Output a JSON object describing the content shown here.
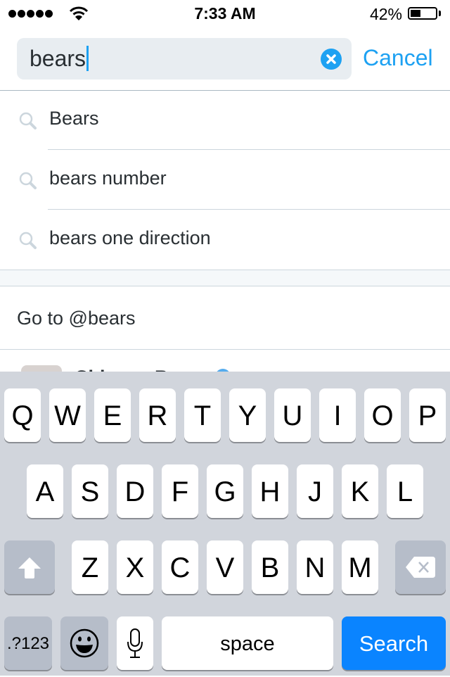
{
  "status_bar": {
    "signal_bars": 5,
    "time": "7:33 AM",
    "battery_percent_label": "42%",
    "battery_level": 0.42
  },
  "search": {
    "query": "bears",
    "clear_icon": "clear-circle-icon",
    "cancel_label": "Cancel",
    "accent_color": "#1da1f2"
  },
  "suggestions": [
    {
      "label": "Bears",
      "icon": "search-icon"
    },
    {
      "label": "bears number",
      "icon": "search-icon"
    },
    {
      "label": "bears one direction",
      "icon": "search-icon"
    }
  ],
  "goto": {
    "label": "Go to @bears"
  },
  "user_result": {
    "name": "Chicago Bears",
    "verified": true
  },
  "keyboard": {
    "row1": [
      "Q",
      "W",
      "E",
      "R",
      "T",
      "Y",
      "U",
      "I",
      "O",
      "P"
    ],
    "row2": [
      "A",
      "S",
      "D",
      "F",
      "G",
      "H",
      "J",
      "K",
      "L"
    ],
    "row3": [
      "Z",
      "X",
      "C",
      "V",
      "B",
      "N",
      "M"
    ],
    "shift_icon": "shift-arrow-icon",
    "delete_icon": "backspace-icon",
    "numbers_label": ".?123",
    "emoji_icon": "emoji-icon",
    "mic_icon": "microphone-icon",
    "space_label": "space",
    "search_label": "Search",
    "search_color": "#0a84ff"
  }
}
